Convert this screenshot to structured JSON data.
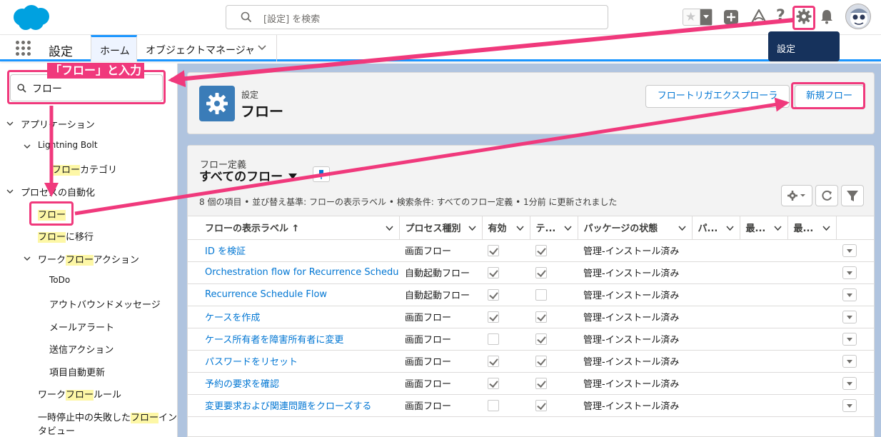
{
  "header": {
    "search_placeholder": "[設定] を検索",
    "tooltip": "設定"
  },
  "nav": {
    "app_name": "設定",
    "tabs": [
      {
        "label": "ホーム"
      },
      {
        "label": "オブジェクトマネージャ"
      }
    ]
  },
  "sidebar": {
    "quick_find_value": "フロー",
    "callout": "「フロー」と入力",
    "items": [
      {
        "pre": "アプリケーション",
        "hl": "",
        "post": ""
      },
      {
        "pre": "Lightning Bolt",
        "hl": "",
        "post": ""
      },
      {
        "pre": "",
        "hl": "フロー",
        "post": "カテゴリ"
      },
      {
        "pre": "プロセスの自動化",
        "hl": "",
        "post": ""
      },
      {
        "pre": "",
        "hl": "フロー",
        "post": ""
      },
      {
        "pre": "",
        "hl": "フロー",
        "post": "に移行"
      },
      {
        "pre": "ワーク",
        "hl": "フロー",
        "post": "アクション"
      },
      {
        "pre": "ToDo",
        "hl": "",
        "post": ""
      },
      {
        "pre": "アウトバウンドメッセージ",
        "hl": "",
        "post": ""
      },
      {
        "pre": "メールアラート",
        "hl": "",
        "post": ""
      },
      {
        "pre": "送信アクション",
        "hl": "",
        "post": ""
      },
      {
        "pre": "項目自動更新",
        "hl": "",
        "post": ""
      },
      {
        "pre": "ワーク",
        "hl": "フロー",
        "post": "ルール"
      },
      {
        "pre": "一時停止中の失敗した",
        "hl": "フロー",
        "post": "イン"
      },
      {
        "pre": "タビュー",
        "hl": "",
        "post": ""
      }
    ]
  },
  "page_header": {
    "subtitle": "設定",
    "title": "フロー",
    "btn_explorer": "フロートリガエクスプローラ",
    "btn_new": "新規フロー"
  },
  "list": {
    "object_label": "フロー定義",
    "view_name": "すべてのフロー",
    "info": "8 個の項目 • 並び替え基準: フローの表示ラベル • 検索条件: すべてのフロー定義 • 1分前 に更新されました",
    "columns": [
      {
        "label": "フローの表示ラベル ↑"
      },
      {
        "label": "プロセス種別"
      },
      {
        "label": "有効"
      },
      {
        "label": "テ..."
      },
      {
        "label": "パッケージの状態"
      },
      {
        "label": "パ..."
      },
      {
        "label": "最..."
      },
      {
        "label": "最..."
      }
    ],
    "rows": [
      {
        "label": "ID を検証",
        "type": "画面フロー",
        "active": true,
        "template": true,
        "pkg": "管理-インストール済み"
      },
      {
        "label": "Orchestration flow for Recurrence Scheduler",
        "type": "自動起動フロー",
        "active": true,
        "template": true,
        "pkg": "管理-インストール済み"
      },
      {
        "label": "Recurrence Schedule Flow",
        "type": "自動起動フロー",
        "active": true,
        "template": false,
        "pkg": "管理-インストール済み"
      },
      {
        "label": "ケースを作成",
        "type": "画面フロー",
        "active": true,
        "template": true,
        "pkg": "管理-インストール済み"
      },
      {
        "label": "ケース所有者を障害所有者に変更",
        "type": "画面フロー",
        "active": false,
        "template": true,
        "pkg": "管理-インストール済み"
      },
      {
        "label": "パスワードをリセット",
        "type": "画面フロー",
        "active": true,
        "template": true,
        "pkg": "管理-インストール済み"
      },
      {
        "label": "予約の要求を確認",
        "type": "画面フロー",
        "active": true,
        "template": true,
        "pkg": "管理-インストール済み"
      },
      {
        "label": "変更要求および関連問題をクローズする",
        "type": "画面フロー",
        "active": false,
        "template": true,
        "pkg": "管理-インストール済み"
      }
    ]
  },
  "colors": {
    "accent": "#0176d3",
    "annotation": "#f0397c",
    "highlight": "#fdf7a6"
  }
}
